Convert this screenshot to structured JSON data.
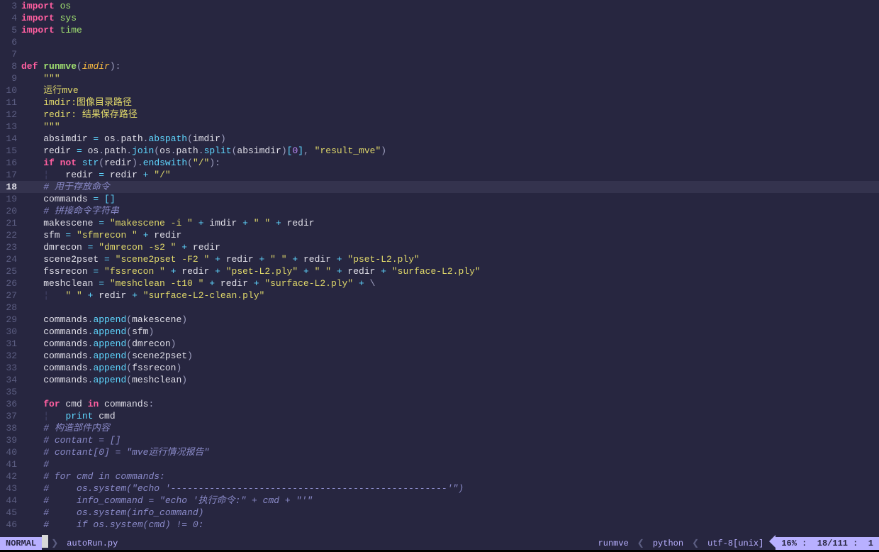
{
  "status": {
    "mode": "NORMAL",
    "file": "autoRun.py",
    "func": "runmve",
    "lang": "python",
    "encoding": "utf-8[unix]",
    "percent": "16%",
    "line": "18",
    "total": "111",
    "col": "1"
  },
  "code": {
    "cursor_line": 18,
    "lines": [
      {
        "n": 3,
        "tokens": [
          [
            "kw",
            "import"
          ],
          [
            "",
            ""
          ],
          [
            "id",
            " "
          ],
          [
            "mod",
            "os"
          ]
        ]
      },
      {
        "n": 4,
        "tokens": [
          [
            "kw",
            "import"
          ],
          [
            "id",
            " "
          ],
          [
            "mod",
            "sys"
          ]
        ]
      },
      {
        "n": 5,
        "tokens": [
          [
            "kw",
            "import"
          ],
          [
            "id",
            " "
          ],
          [
            "mod",
            "time"
          ]
        ]
      },
      {
        "n": 6,
        "tokens": []
      },
      {
        "n": 7,
        "tokens": []
      },
      {
        "n": 8,
        "tokens": [
          [
            "kw",
            "def"
          ],
          [
            "id",
            " "
          ],
          [
            "def",
            "runmve"
          ],
          [
            "pun",
            "("
          ],
          [
            "prm",
            "imdir"
          ],
          [
            "pun",
            ")"
          ],
          [
            "pun",
            ":"
          ]
        ]
      },
      {
        "n": 9,
        "tokens": [
          [
            "id",
            "    "
          ],
          [
            "str",
            "\"\"\""
          ]
        ]
      },
      {
        "n": 10,
        "tokens": [
          [
            "id",
            "    "
          ],
          [
            "str",
            "运行mve"
          ]
        ]
      },
      {
        "n": 11,
        "tokens": [
          [
            "id",
            "    "
          ],
          [
            "str",
            "imdir:图像目录路径"
          ]
        ]
      },
      {
        "n": 12,
        "tokens": [
          [
            "id",
            "    "
          ],
          [
            "str",
            "redir: 结果保存路径"
          ]
        ]
      },
      {
        "n": 13,
        "tokens": [
          [
            "id",
            "    "
          ],
          [
            "str",
            "\"\"\""
          ]
        ]
      },
      {
        "n": 14,
        "tokens": [
          [
            "id",
            "    absimdir "
          ],
          [
            "op",
            "="
          ],
          [
            "id",
            " os"
          ],
          [
            "pun",
            "."
          ],
          [
            "id",
            "path"
          ],
          [
            "pun",
            "."
          ],
          [
            "fn",
            "abspath"
          ],
          [
            "pun",
            "("
          ],
          [
            "id",
            "imdir"
          ],
          [
            "pun",
            ")"
          ]
        ]
      },
      {
        "n": 15,
        "tokens": [
          [
            "id",
            "    redir "
          ],
          [
            "op",
            "="
          ],
          [
            "id",
            " os"
          ],
          [
            "pun",
            "."
          ],
          [
            "id",
            "path"
          ],
          [
            "pun",
            "."
          ],
          [
            "fn",
            "join"
          ],
          [
            "pun",
            "("
          ],
          [
            "id",
            "os"
          ],
          [
            "pun",
            "."
          ],
          [
            "id",
            "path"
          ],
          [
            "pun",
            "."
          ],
          [
            "fn",
            "split"
          ],
          [
            "pun",
            "("
          ],
          [
            "id",
            "absimdir"
          ],
          [
            "pun",
            ")"
          ],
          [
            "brk",
            "["
          ],
          [
            "num",
            "0"
          ],
          [
            "brk",
            "]"
          ],
          [
            "pun",
            ", "
          ],
          [
            "str",
            "\"result_mve\""
          ],
          [
            "pun",
            ")"
          ]
        ]
      },
      {
        "n": 16,
        "tokens": [
          [
            "id",
            "    "
          ],
          [
            "kw",
            "if"
          ],
          [
            "id",
            " "
          ],
          [
            "kw",
            "not"
          ],
          [
            "id",
            " "
          ],
          [
            "fn",
            "str"
          ],
          [
            "pun",
            "("
          ],
          [
            "id",
            "redir"
          ],
          [
            "pun",
            ")"
          ],
          [
            "pun",
            "."
          ],
          [
            "fn",
            "endswith"
          ],
          [
            "pun",
            "("
          ],
          [
            "str",
            "\"/\""
          ],
          [
            "pun",
            ")"
          ],
          [
            "pun",
            ":"
          ]
        ]
      },
      {
        "n": 17,
        "tokens": [
          [
            "id",
            "    "
          ],
          [
            "ind",
            "¦"
          ],
          [
            "id",
            "   redir "
          ],
          [
            "op",
            "="
          ],
          [
            "id",
            " redir "
          ],
          [
            "op",
            "+"
          ],
          [
            "id",
            " "
          ],
          [
            "str",
            "\"/\""
          ]
        ]
      },
      {
        "n": 18,
        "tokens": [
          [
            "id",
            "    "
          ],
          [
            "com",
            "# 用于存放命令"
          ]
        ]
      },
      {
        "n": 19,
        "tokens": [
          [
            "id",
            "    commands "
          ],
          [
            "op",
            "="
          ],
          [
            "id",
            " "
          ],
          [
            "brk",
            "[]"
          ]
        ]
      },
      {
        "n": 20,
        "tokens": [
          [
            "id",
            "    "
          ],
          [
            "com",
            "# 拼接命令字符串"
          ]
        ]
      },
      {
        "n": 21,
        "tokens": [
          [
            "id",
            "    makescene "
          ],
          [
            "op",
            "="
          ],
          [
            "id",
            " "
          ],
          [
            "str",
            "\"makescene -i \""
          ],
          [
            "id",
            " "
          ],
          [
            "op",
            "+"
          ],
          [
            "id",
            " imdir "
          ],
          [
            "op",
            "+"
          ],
          [
            "id",
            " "
          ],
          [
            "str",
            "\" \""
          ],
          [
            "id",
            " "
          ],
          [
            "op",
            "+"
          ],
          [
            "id",
            " redir"
          ]
        ]
      },
      {
        "n": 22,
        "tokens": [
          [
            "id",
            "    sfm "
          ],
          [
            "op",
            "="
          ],
          [
            "id",
            " "
          ],
          [
            "str",
            "\"sfmrecon \""
          ],
          [
            "id",
            " "
          ],
          [
            "op",
            "+"
          ],
          [
            "id",
            " redir"
          ]
        ]
      },
      {
        "n": 23,
        "tokens": [
          [
            "id",
            "    dmrecon "
          ],
          [
            "op",
            "="
          ],
          [
            "id",
            " "
          ],
          [
            "str",
            "\"dmrecon -s2 \""
          ],
          [
            "id",
            " "
          ],
          [
            "op",
            "+"
          ],
          [
            "id",
            " redir"
          ]
        ]
      },
      {
        "n": 24,
        "tokens": [
          [
            "id",
            "    scene2pset "
          ],
          [
            "op",
            "="
          ],
          [
            "id",
            " "
          ],
          [
            "str",
            "\"scene2pset -F2 \""
          ],
          [
            "id",
            " "
          ],
          [
            "op",
            "+"
          ],
          [
            "id",
            " redir "
          ],
          [
            "op",
            "+"
          ],
          [
            "id",
            " "
          ],
          [
            "str",
            "\" \""
          ],
          [
            "id",
            " "
          ],
          [
            "op",
            "+"
          ],
          [
            "id",
            " redir "
          ],
          [
            "op",
            "+"
          ],
          [
            "id",
            " "
          ],
          [
            "str",
            "\"pset-L2.ply\""
          ]
        ]
      },
      {
        "n": 25,
        "tokens": [
          [
            "id",
            "    fssrecon "
          ],
          [
            "op",
            "="
          ],
          [
            "id",
            " "
          ],
          [
            "str",
            "\"fssrecon \""
          ],
          [
            "id",
            " "
          ],
          [
            "op",
            "+"
          ],
          [
            "id",
            " redir "
          ],
          [
            "op",
            "+"
          ],
          [
            "id",
            " "
          ],
          [
            "str",
            "\"pset-L2.ply\""
          ],
          [
            "id",
            " "
          ],
          [
            "op",
            "+"
          ],
          [
            "id",
            " "
          ],
          [
            "str",
            "\" \""
          ],
          [
            "id",
            " "
          ],
          [
            "op",
            "+"
          ],
          [
            "id",
            " redir "
          ],
          [
            "op",
            "+"
          ],
          [
            "id",
            " "
          ],
          [
            "str",
            "\"surface-L2.ply\""
          ]
        ]
      },
      {
        "n": 26,
        "tokens": [
          [
            "id",
            "    meshclean "
          ],
          [
            "op",
            "="
          ],
          [
            "id",
            " "
          ],
          [
            "str",
            "\"meshclean -t10 \""
          ],
          [
            "id",
            " "
          ],
          [
            "op",
            "+"
          ],
          [
            "id",
            " redir "
          ],
          [
            "op",
            "+"
          ],
          [
            "id",
            " "
          ],
          [
            "str",
            "\"surface-L2.ply\""
          ],
          [
            "id",
            " "
          ],
          [
            "op",
            "+"
          ],
          [
            "id",
            " "
          ],
          [
            "pun",
            "\\"
          ]
        ]
      },
      {
        "n": 27,
        "tokens": [
          [
            "id",
            "    "
          ],
          [
            "ind",
            "¦"
          ],
          [
            "id",
            "   "
          ],
          [
            "str",
            "\" \""
          ],
          [
            "id",
            " "
          ],
          [
            "op",
            "+"
          ],
          [
            "id",
            " redir "
          ],
          [
            "op",
            "+"
          ],
          [
            "id",
            " "
          ],
          [
            "str",
            "\"surface-L2-clean.ply\""
          ]
        ]
      },
      {
        "n": 28,
        "tokens": []
      },
      {
        "n": 29,
        "tokens": [
          [
            "id",
            "    commands"
          ],
          [
            "pun",
            "."
          ],
          [
            "fn",
            "append"
          ],
          [
            "pun",
            "("
          ],
          [
            "id",
            "makescene"
          ],
          [
            "pun",
            ")"
          ]
        ]
      },
      {
        "n": 30,
        "tokens": [
          [
            "id",
            "    commands"
          ],
          [
            "pun",
            "."
          ],
          [
            "fn",
            "append"
          ],
          [
            "pun",
            "("
          ],
          [
            "id",
            "sfm"
          ],
          [
            "pun",
            ")"
          ]
        ]
      },
      {
        "n": 31,
        "tokens": [
          [
            "id",
            "    commands"
          ],
          [
            "pun",
            "."
          ],
          [
            "fn",
            "append"
          ],
          [
            "pun",
            "("
          ],
          [
            "id",
            "dmrecon"
          ],
          [
            "pun",
            ")"
          ]
        ]
      },
      {
        "n": 32,
        "tokens": [
          [
            "id",
            "    commands"
          ],
          [
            "pun",
            "."
          ],
          [
            "fn",
            "append"
          ],
          [
            "pun",
            "("
          ],
          [
            "id",
            "scene2pset"
          ],
          [
            "pun",
            ")"
          ]
        ]
      },
      {
        "n": 33,
        "tokens": [
          [
            "id",
            "    commands"
          ],
          [
            "pun",
            "."
          ],
          [
            "fn",
            "append"
          ],
          [
            "pun",
            "("
          ],
          [
            "id",
            "fssrecon"
          ],
          [
            "pun",
            ")"
          ]
        ]
      },
      {
        "n": 34,
        "tokens": [
          [
            "id",
            "    commands"
          ],
          [
            "pun",
            "."
          ],
          [
            "fn",
            "append"
          ],
          [
            "pun",
            "("
          ],
          [
            "id",
            "meshclean"
          ],
          [
            "pun",
            ")"
          ]
        ]
      },
      {
        "n": 35,
        "tokens": []
      },
      {
        "n": 36,
        "tokens": [
          [
            "id",
            "    "
          ],
          [
            "kw",
            "for"
          ],
          [
            "id",
            " cmd "
          ],
          [
            "kw",
            "in"
          ],
          [
            "id",
            " commands"
          ],
          [
            "pun",
            ":"
          ]
        ]
      },
      {
        "n": 37,
        "tokens": [
          [
            "id",
            "    "
          ],
          [
            "ind",
            "¦"
          ],
          [
            "id",
            "   "
          ],
          [
            "fn",
            "print"
          ],
          [
            "id",
            " cmd"
          ]
        ]
      },
      {
        "n": 38,
        "tokens": [
          [
            "id",
            "    "
          ],
          [
            "com",
            "# 构造部件内容"
          ]
        ]
      },
      {
        "n": 39,
        "tokens": [
          [
            "id",
            "    "
          ],
          [
            "com",
            "# contant = []"
          ]
        ]
      },
      {
        "n": 40,
        "tokens": [
          [
            "id",
            "    "
          ],
          [
            "com",
            "# contant[0] = \"mve运行情况报告\""
          ]
        ]
      },
      {
        "n": 41,
        "tokens": [
          [
            "id",
            "    "
          ],
          [
            "com",
            "#"
          ]
        ]
      },
      {
        "n": 42,
        "tokens": [
          [
            "id",
            "    "
          ],
          [
            "com",
            "# for cmd in commands:"
          ]
        ]
      },
      {
        "n": 43,
        "tokens": [
          [
            "id",
            "    "
          ],
          [
            "com",
            "#     os.system(\"echo '--------------------------------------------------'\")"
          ]
        ]
      },
      {
        "n": 44,
        "tokens": [
          [
            "id",
            "    "
          ],
          [
            "com",
            "#     info_command = \"echo '执行命令:\" + cmd + \"'\""
          ]
        ]
      },
      {
        "n": 45,
        "tokens": [
          [
            "id",
            "    "
          ],
          [
            "com",
            "#     os.system(info_command)"
          ]
        ]
      },
      {
        "n": 46,
        "tokens": [
          [
            "id",
            "    "
          ],
          [
            "com",
            "#     if os.system(cmd) != 0:"
          ]
        ]
      }
    ]
  }
}
